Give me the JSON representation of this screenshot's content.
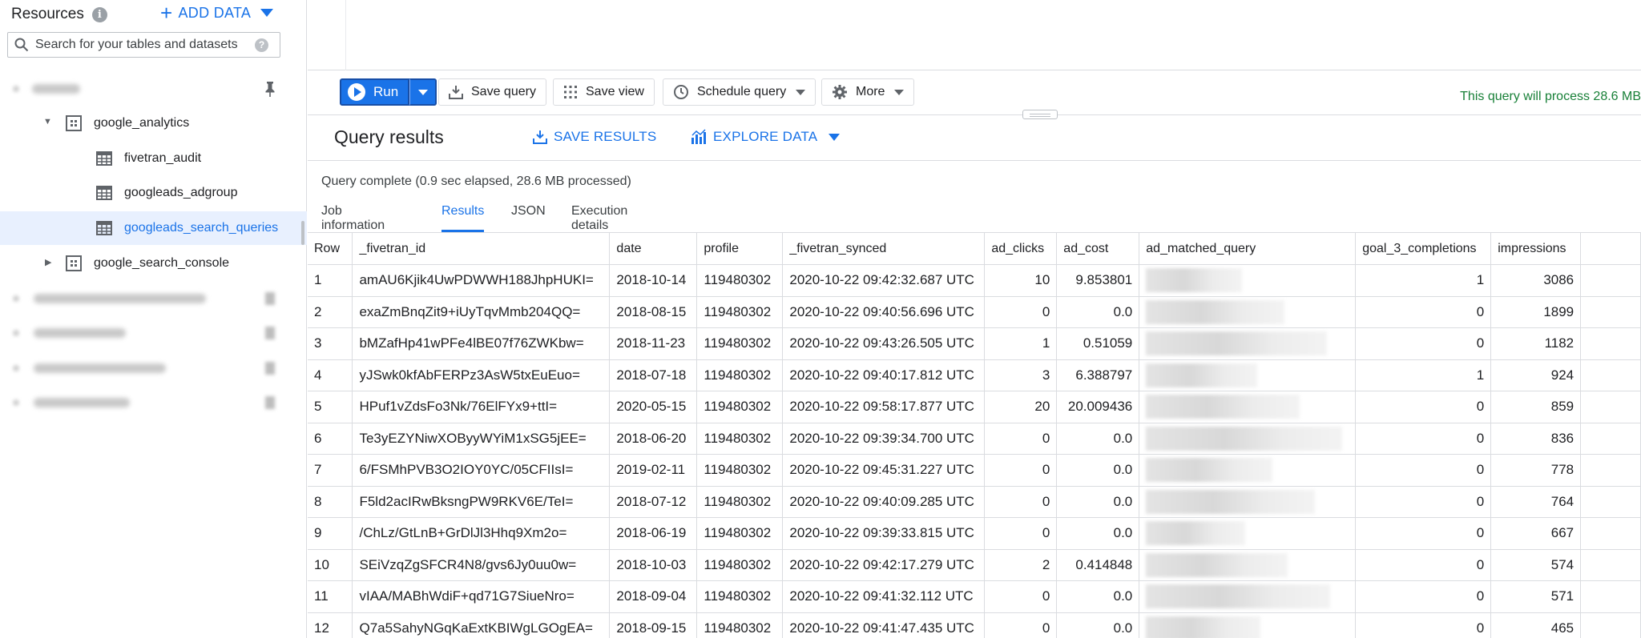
{
  "sidebar": {
    "title": "Resources",
    "add_data": "ADD DATA",
    "search_placeholder": "Search for your tables and datasets",
    "datasets": [
      {
        "name": "google_analytics",
        "tables": [
          "fivetran_audit",
          "googleads_adgroup",
          "googleads_search_queries"
        ]
      },
      {
        "name": "google_search_console"
      }
    ]
  },
  "toolbar": {
    "run": "Run",
    "save_query": "Save query",
    "save_view": "Save view",
    "schedule_query": "Schedule query",
    "more": "More",
    "process_msg": "This query will process 28.6 MB"
  },
  "results": {
    "title": "Query results",
    "save_results": "SAVE RESULTS",
    "explore_data": "EXPLORE DATA",
    "status": "Query complete (0.9 sec elapsed, 28.6 MB processed)",
    "tabs": [
      "Job information",
      "Results",
      "JSON",
      "Execution details"
    ]
  },
  "table": {
    "columns": [
      "Row",
      "_fivetran_id",
      "date",
      "profile",
      "_fivetran_synced",
      "ad_clicks",
      "ad_cost",
      "ad_matched_query",
      "goal_3_completions",
      "impressions"
    ],
    "rows": [
      [
        "1",
        "amAU6Kjik4UwPDWWH188JhpHUKI=",
        "2018-10-14",
        "119480302",
        "2020-10-22 09:42:32.687 UTC",
        "10",
        "9.853801",
        "",
        "1",
        "3086"
      ],
      [
        "2",
        "exaZmBnqZit9+iUyTqvMmb204QQ=",
        "2018-08-15",
        "119480302",
        "2020-10-22 09:40:56.696 UTC",
        "0",
        "0.0",
        "",
        "0",
        "1899"
      ],
      [
        "3",
        "bMZafHp41wPFe4lBE07f76ZWKbw=",
        "2018-11-23",
        "119480302",
        "2020-10-22 09:43:26.505 UTC",
        "1",
        "0.51059",
        "",
        "0",
        "1182"
      ],
      [
        "4",
        "yJSwk0kfAbFERPz3AsW5txEuEuo=",
        "2018-07-18",
        "119480302",
        "2020-10-22 09:40:17.812 UTC",
        "3",
        "6.388797",
        "",
        "1",
        "924"
      ],
      [
        "5",
        "HPuf1vZdsFo3Nk/76ElFYx9+ttI=",
        "2020-05-15",
        "119480302",
        "2020-10-22 09:58:17.877 UTC",
        "20",
        "20.009436",
        "",
        "0",
        "859"
      ],
      [
        "6",
        "Te3yEZYNiwXOByyWYiM1xSG5jEE=",
        "2018-06-20",
        "119480302",
        "2020-10-22 09:39:34.700 UTC",
        "0",
        "0.0",
        "",
        "0",
        "836"
      ],
      [
        "7",
        "6/FSMhPVB3O2IOY0YC/05CFIIsI=",
        "2019-02-11",
        "119480302",
        "2020-10-22 09:45:31.227 UTC",
        "0",
        "0.0",
        "",
        "0",
        "778"
      ],
      [
        "8",
        "F5ld2acIRwBksngPW9RKV6E/TeI=",
        "2018-07-12",
        "119480302",
        "2020-10-22 09:40:09.285 UTC",
        "0",
        "0.0",
        "",
        "0",
        "764"
      ],
      [
        "9",
        "/ChLz/GtLnB+GrDlJl3Hhq9Xm2o=",
        "2018-06-19",
        "119480302",
        "2020-10-22 09:39:33.815 UTC",
        "0",
        "0.0",
        "",
        "0",
        "667"
      ],
      [
        "10",
        "SEiVzqZgSFCR4N8/gvs6Jy0uu0w=",
        "2018-10-03",
        "119480302",
        "2020-10-22 09:42:17.279 UTC",
        "2",
        "0.414848",
        "",
        "0",
        "574"
      ],
      [
        "11",
        "vIAA/MABhWdiF+qd71G7SiueNro=",
        "2018-09-04",
        "119480302",
        "2020-10-22 09:41:32.112 UTC",
        "0",
        "0.0",
        "",
        "0",
        "571"
      ],
      [
        "12",
        "Q7a5SahyNGqKaExtKBIWgLGOgEA=",
        "2018-09-15",
        "119480302",
        "2020-10-22 09:41:47.435 UTC",
        "0",
        "0.0",
        "",
        "0",
        "465"
      ]
    ]
  },
  "colors": {
    "accent": "#1a73e8",
    "success": "#188038",
    "selected_bg": "#e8f0fe",
    "border": "#dadce0"
  },
  "icons": [
    "info-icon",
    "add-icon",
    "search-icon",
    "help-icon",
    "pin-icon",
    "dataset-icon",
    "table-icon",
    "play-icon",
    "download-icon",
    "grid-icon",
    "clock-icon",
    "gear-icon",
    "chart-icon"
  ]
}
